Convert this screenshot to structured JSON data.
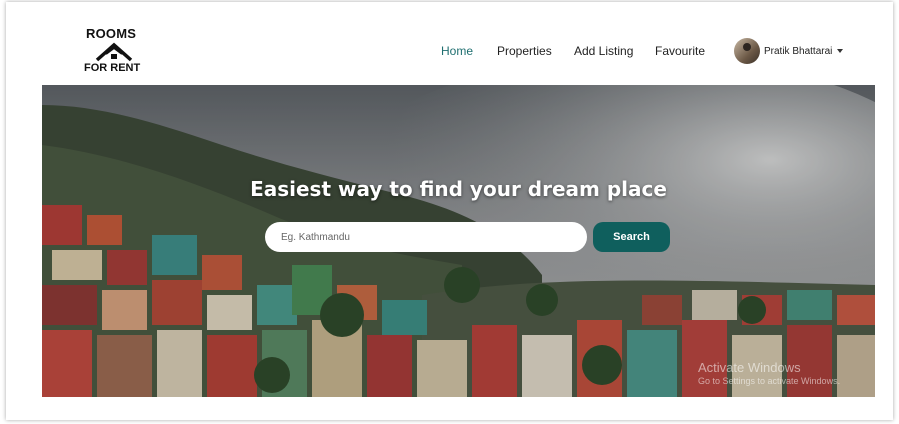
{
  "brand": {
    "logo_top": "ROOMS",
    "logo_bottom": "FOR RENT",
    "icon": "house-icon"
  },
  "nav": {
    "items": [
      {
        "label": "Home",
        "active": true
      },
      {
        "label": "Properties"
      },
      {
        "label": "Add Listing"
      },
      {
        "label": "Favourite"
      }
    ],
    "active_color": "#1f6f70"
  },
  "user": {
    "name": "Pratik Bhattarai",
    "dropdown_icon": "caret-down-icon"
  },
  "hero": {
    "title": "Easiest way to find your dream place",
    "search": {
      "placeholder": "Eg. Kathmandu",
      "value": "",
      "button_label": "Search",
      "button_color": "#0f5f5d"
    }
  },
  "os_watermark": {
    "line1": "Activate Windows",
    "line2": "Go to Settings to activate Windows."
  }
}
